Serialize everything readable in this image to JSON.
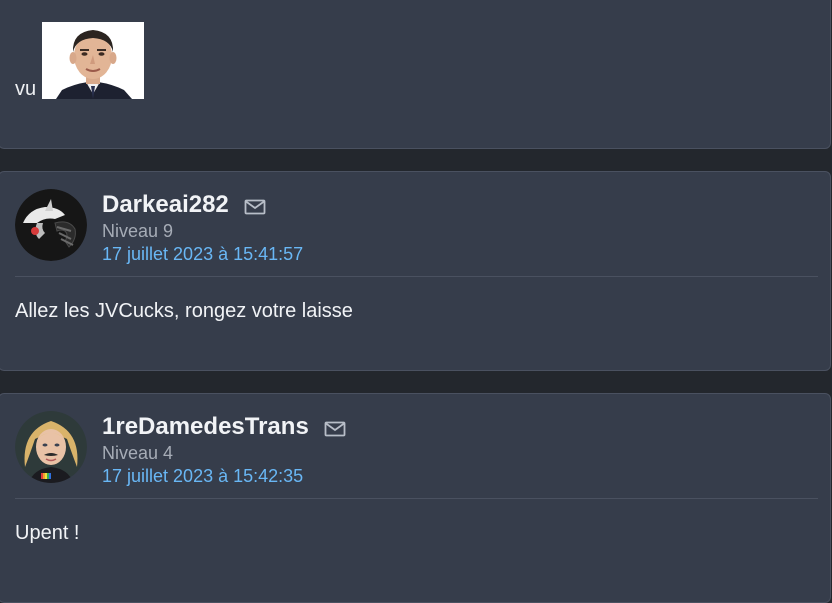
{
  "posts": [
    {
      "message": "vu",
      "sticker": "politician-portrait-sticker"
    },
    {
      "pseudo": "Darkeai282",
      "level": "Niveau 9",
      "date": "17 juillet 2023 à 15:41:57",
      "message": "Allez les JVCucks, rongez votre laisse",
      "avatar": "dark-pokemon-avatar"
    },
    {
      "pseudo": "1reDamedesTrans",
      "level": "Niveau 4",
      "date": "17 juillet 2023 à 15:42:35",
      "message": "Upent !",
      "avatar": "blonde-woman-avatar"
    }
  ],
  "icons": {
    "mail": "envelope-icon"
  },
  "colors": {
    "page_bg": "#23272d",
    "post_bg": "#363d4b",
    "date_link": "#69b7f5",
    "level_text": "#a6acb6"
  }
}
